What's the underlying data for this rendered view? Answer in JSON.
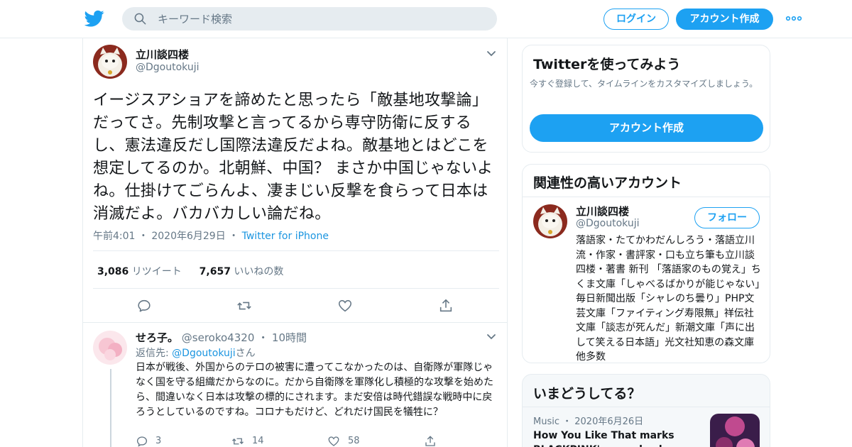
{
  "topbar": {
    "logo": "twitter-bird-icon",
    "search_placeholder": "キーワード検索",
    "login_label": "ログイン",
    "signup_label": "アカウント作成",
    "more_icon": "more-dots-icon"
  },
  "tweet": {
    "author_name": "立川談四楼",
    "author_handle": "@Dgoutokuji",
    "text": "イージスアショアを諦めたと思ったら「敵基地攻撃論」だってさ。先制攻撃と言ってるから専守防衛に反するし、憲法違反だし国際法違反だよね。敵基地とはどこを想定してるのか。北朝鮮、中国？ まさか中国じゃないよね。仕掛けてごらんよ、凄まじい反撃を食らって日本は消滅だよ。バカバカしい論だね。",
    "time": "午前4:01",
    "date": "2020年6月29日",
    "source": "Twitter for iPhone",
    "retweets_count": "3,086",
    "retweets_label": "リツイート",
    "likes_count": "7,657",
    "likes_label": "いいねの数",
    "actions": [
      "reply-icon",
      "retweet-icon",
      "like-icon",
      "share-icon"
    ]
  },
  "reply": {
    "name": "せろ子。",
    "handle": "@seroko4320",
    "time": "10時間",
    "reply_to_prefix": "返信先: ",
    "reply_to_handle": "@Dgoutokuji",
    "reply_to_suffix": "さん",
    "text": "日本が戦後、外国からのテロの被害に遭ってこなかったのは、自衛隊が軍隊じゃなく国を守る組織だからなのに。だから自衛隊を軍隊化し積極的な攻撃を始めたら、間違いなく日本は攻撃の標的にされます。まだ安倍は時代錯誤な戦時中に戻ろうとしているのですね。コロナもだけど、どれだけ国民を犠牲に？",
    "reply_count": "3",
    "retweet_count": "14",
    "like_count": "58"
  },
  "sidebar": {
    "try": {
      "title": "Twitterを使ってみよう",
      "subtitle": "今すぐ登録して、タイムラインをカスタマイズしましょう。",
      "button": "アカウント作成"
    },
    "related": {
      "title": "関連性の高いアカウント",
      "name": "立川談四楼",
      "handle": "@Dgoutokuji",
      "follow_label": "フォロー",
      "bio": "落語家・たてかわだんしろう・落語立川流・作家・書評家・口も立ち筆も立川談四楼・著書 新刊 「落語家のもの覚え」ちくま文庫「しゃべるばかりが能じゃない」毎日新聞出版「シャレのち曇り」PHP文芸文庫「ファイティング寿限無」祥伝社文庫「談志が死んだ」新潮文庫「声に出して笑える日本語」光文社知恵の森文庫他多数"
    },
    "trends": {
      "title": "いまどうしてる？",
      "category": "Music",
      "date": "2020年6月26日",
      "headline": "How You Like That marks BLACKPINK's comeback"
    }
  },
  "colors": {
    "accent": "#1da1f2",
    "link": "#1b95e0",
    "muted": "#657786",
    "text": "#14171a",
    "border": "#e6ecf0"
  }
}
